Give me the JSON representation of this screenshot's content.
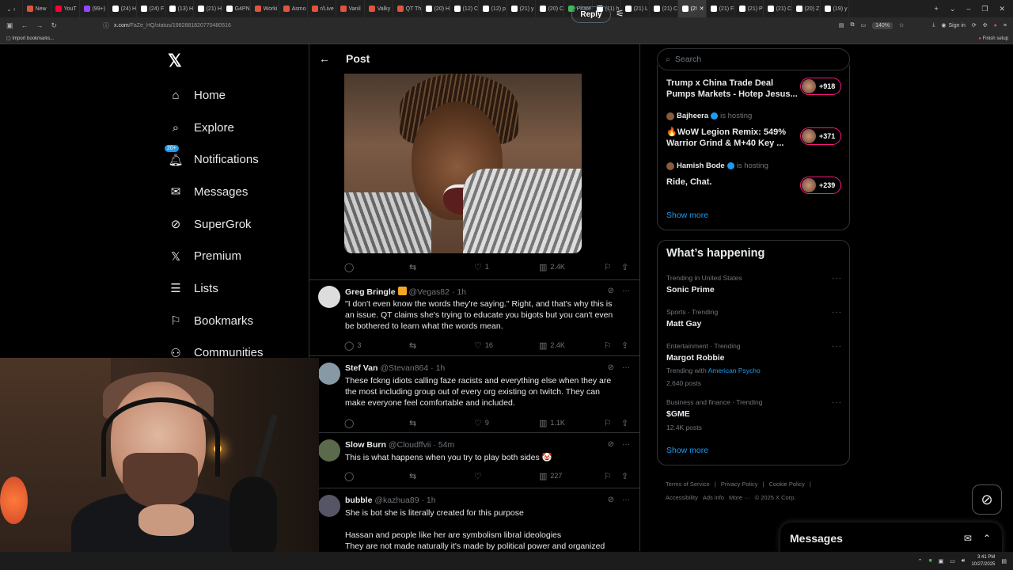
{
  "browser": {
    "tabs": [
      {
        "label": "New",
        "fav": "reddit"
      },
      {
        "label": "YouT",
        "fav": "youtube"
      },
      {
        "label": "(99+)",
        "fav": "twitch"
      },
      {
        "label": "(24) H",
        "fav": "x"
      },
      {
        "label": "(24) F",
        "fav": "x"
      },
      {
        "label": "(13) H",
        "fav": "x"
      },
      {
        "label": "(21) H",
        "fav": "x"
      },
      {
        "label": "G4PN",
        "fav": "x"
      },
      {
        "label": "Worki",
        "fav": "reddit"
      },
      {
        "label": "Asmo",
        "fav": "reddit"
      },
      {
        "label": "r/Live",
        "fav": "reddit"
      },
      {
        "label": "Vanil",
        "fav": "reddit"
      },
      {
        "label": "Valky",
        "fav": "reddit"
      },
      {
        "label": "QT Th",
        "fav": "reddit"
      },
      {
        "label": "(20) H",
        "fav": "x"
      },
      {
        "label": "(12) C",
        "fav": "x"
      },
      {
        "label": "(12) p",
        "fav": "x"
      },
      {
        "label": "(21) y",
        "fav": "x"
      },
      {
        "label": "(20) C",
        "fav": "x"
      },
      {
        "label": "Pirate",
        "fav": "green"
      },
      {
        "label": "(11) h",
        "fav": "x"
      },
      {
        "label": "(21) L",
        "fav": "x"
      },
      {
        "label": "(21) C",
        "fav": "x"
      },
      {
        "label": "(2!",
        "fav": "x",
        "active": true
      },
      {
        "label": "(21) F",
        "fav": "x"
      },
      {
        "label": "(21) P",
        "fav": "x"
      },
      {
        "label": "(21) C",
        "fav": "x"
      },
      {
        "label": "(20) Z",
        "fav": "x"
      },
      {
        "label": "(19) y",
        "fav": "x"
      }
    ],
    "url_host": "x.com",
    "url_path": "/FaZe_HQ/status/1982881820770480516",
    "zoom": "140%",
    "signin": "Sign in",
    "import_bookmarks": "Import bookmarks...",
    "finish_setup": "Finish setup"
  },
  "sidebar": {
    "logo": "𝕏",
    "items": [
      {
        "label": "Home",
        "icon": "home-icon",
        "glyph": "⌂"
      },
      {
        "label": "Explore",
        "icon": "search-icon",
        "glyph": "⌕"
      },
      {
        "label": "Notifications",
        "icon": "bell-icon",
        "glyph": "🔔︎",
        "badge": "20+"
      },
      {
        "label": "Messages",
        "icon": "envelope-icon",
        "glyph": "✉"
      },
      {
        "label": "SuperGrok",
        "icon": "grok-icon",
        "glyph": "⊘"
      },
      {
        "label": "Premium",
        "icon": "x-premium-icon",
        "glyph": "𝕏"
      },
      {
        "label": "Lists",
        "icon": "list-icon",
        "glyph": "☰"
      },
      {
        "label": "Bookmarks",
        "icon": "bookmark-icon",
        "glyph": "⚐"
      },
      {
        "label": "Communities",
        "icon": "communities-icon",
        "glyph": "⚇"
      }
    ]
  },
  "post": {
    "header_title": "Post",
    "reply_label": "Reply",
    "media_actions": {
      "replies": "",
      "reposts": "",
      "likes": "1",
      "views": "2.4K"
    }
  },
  "replies": [
    {
      "name": "Greg Bringle",
      "handle": "@Vegas82",
      "time": "1h",
      "badge": true,
      "text": "\"I don't even know the words they're saying.\" Right, and that's why this is an issue. QT claims she's trying to educate you bigots but you can't even be bothered to learn what the words mean.",
      "replies": "3",
      "reposts": "",
      "likes": "16",
      "views": "2.4K",
      "avatar_color": "#ddd"
    },
    {
      "name": "Stef Van",
      "handle": "@Stevan864",
      "time": "1h",
      "text": "These fckng idiots calling faze racists and everything else when they are the most including group out of every org existing on twitch. They can make everyone feel comfortable and included.",
      "replies": "",
      "reposts": "",
      "likes": "9",
      "views": "1.1K",
      "avatar_color": "#8899a6"
    },
    {
      "name": "Slow Burn",
      "handle": "@Cloudffvii",
      "time": "54m",
      "text": "This is what happens when you try to play both sides 🤡",
      "replies": "",
      "reposts": "",
      "likes": "",
      "views": "227",
      "avatar_color": "#5a6a4a"
    },
    {
      "name": "bubble",
      "handle": "@kazhua89",
      "time": "1h",
      "text_lines": [
        "She is bot she is literally created for this purpose",
        "",
        "Hassan and people like her are  symbolism  libral ideologies",
        "They are not made naturally it's made by political power and organized"
      ]
    }
  ],
  "search": {
    "placeholder": "Search"
  },
  "live": [
    {
      "title_lines": [
        "Trump x China Trade Deal",
        "Pumps Markets - Hotep Jesus..."
      ],
      "count": "+918"
    },
    {
      "host": "Bajheera",
      "hosting": "is hosting",
      "title_lines": [
        "🔥WoW Legion Remix: 549%",
        "Warrior Grind & M+40 Key ..."
      ],
      "count": "+371"
    },
    {
      "host": "Hamish Bode",
      "hosting": "is hosting",
      "title_lines": [
        "Ride, Chat."
      ],
      "count": "+239"
    }
  ],
  "live_show_more": "Show more",
  "happening": {
    "title": "What’s happening",
    "trends": [
      {
        "meta": "Trending in United States",
        "name": "Sonic Prime"
      },
      {
        "meta": "Sports · Trending",
        "name": "Matt Gay"
      },
      {
        "meta": "Entertainment · Trending",
        "name": "Margot Robbie",
        "sub_prefix": "Trending with",
        "sub_link": "American Psycho",
        "posts": "2,640 posts"
      },
      {
        "meta": "Business and finance · Trending",
        "name": "$GME",
        "posts": "12.4K posts"
      }
    ],
    "show_more": "Show more"
  },
  "footer": {
    "links": [
      "Terms of Service",
      "|",
      "Privacy Policy",
      "|",
      "Cookie Policy",
      "|",
      "Accessibility",
      "Ads info",
      "More ···",
      "© 2025 X Corp."
    ]
  },
  "messages_dock": {
    "label": "Messages"
  },
  "taskbar": {
    "time": "3:41 PM",
    "date": "10/27/2025"
  }
}
